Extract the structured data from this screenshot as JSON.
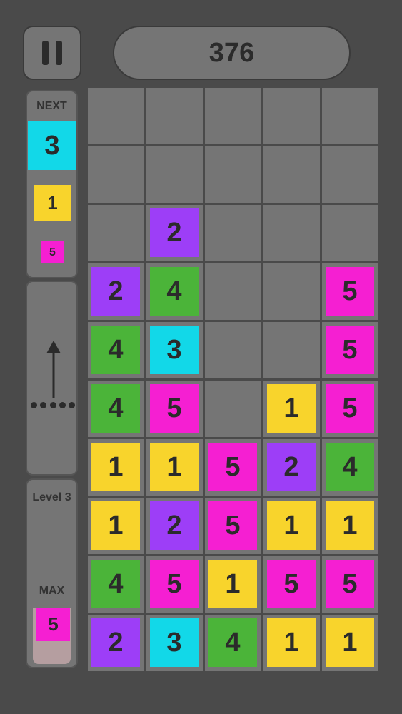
{
  "score": "376",
  "next": {
    "title": "NEXT",
    "queue": [
      {
        "value": "3",
        "color": "#12d8e8"
      },
      {
        "value": "1",
        "color": "#f8d42c"
      },
      {
        "value": "5",
        "color": "#f51fd2"
      }
    ]
  },
  "level": {
    "label": "Level 3",
    "max_label": "MAX",
    "max_tile": {
      "value": "5",
      "color": "#f51fd2"
    }
  },
  "colors": {
    "1": "#f8d42c",
    "2": "#9d3ef7",
    "3": "#12d8e8",
    "4": "#4bb439",
    "5": "#f51fd2",
    "cell": "#757575",
    "background": "#4a4a4a"
  },
  "board": {
    "columns": 5,
    "rows": [
      [
        "",
        "",
        "",
        "",
        ""
      ],
      [
        "",
        "",
        "",
        "",
        ""
      ],
      [
        "",
        "2",
        "",
        "",
        ""
      ],
      [
        "2",
        "4",
        "",
        "",
        "5"
      ],
      [
        "4",
        "3",
        "",
        "",
        "5"
      ],
      [
        "4",
        "5",
        "",
        "1",
        "5"
      ],
      [
        "1",
        "1",
        "5",
        "2",
        "4"
      ],
      [
        "1",
        "2",
        "5",
        "1",
        "1"
      ],
      [
        "4",
        "5",
        "1",
        "5",
        "5"
      ],
      [
        "2",
        "3",
        "4",
        "1",
        "1"
      ]
    ]
  },
  "icons": {
    "pause": "pause-icon",
    "swipe": "swipe-up-arrow-icon"
  }
}
